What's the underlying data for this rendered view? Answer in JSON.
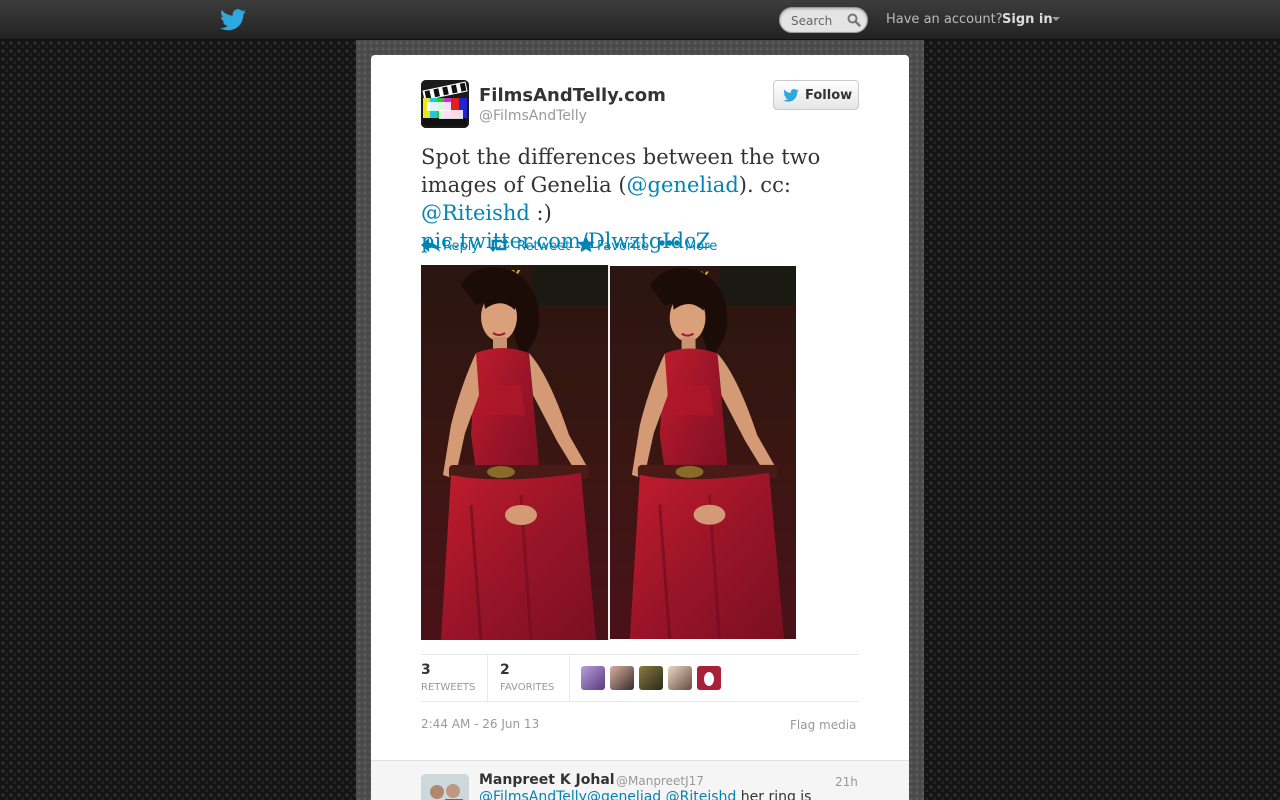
{
  "topbar": {
    "search_placeholder": "Search",
    "have_account": "Have an account?",
    "sign_in": "Sign in",
    "icons": [
      "twitter-bird-icon",
      "search-icon",
      "caret-down-icon"
    ]
  },
  "tweet": {
    "display_name": "FilmsAndTelly.com",
    "screen_name": "@FilmsAndTelly",
    "follow_label": "Follow",
    "text_1": "Spot the differences between the two images of Genelia (",
    "mention_1": "@geneliad",
    "text_2": "). cc: ",
    "mention_2": "@Riteishd",
    "text_3": " :)",
    "pic_link": "pic.twitter.com/DlwztgIdcZ",
    "actions": {
      "reply": "Reply",
      "retweet": "Retweet",
      "favorite": "Favorite",
      "more": "More"
    },
    "stats": {
      "retweets_count": "3",
      "retweets_label": "RETWEETS",
      "favorites_count": "2",
      "favorites_label": "FAVORITES"
    },
    "timestamp": "2:44 AM - 26 Jun 13",
    "flag_media": "Flag media"
  },
  "reply": {
    "display_name": "Manpreet K Johal",
    "screen_name": "@ManpreetJ17",
    "time": "21h",
    "mention_1": "@FilmsAndTelly",
    "mention_2": "@geneliad",
    "mention_3": "@Riteishd",
    "text": " her ring is"
  },
  "colors": {
    "link": "#0084b4",
    "topbar": "#2e2e2e",
    "twitter_blue": "#1da1f2"
  }
}
